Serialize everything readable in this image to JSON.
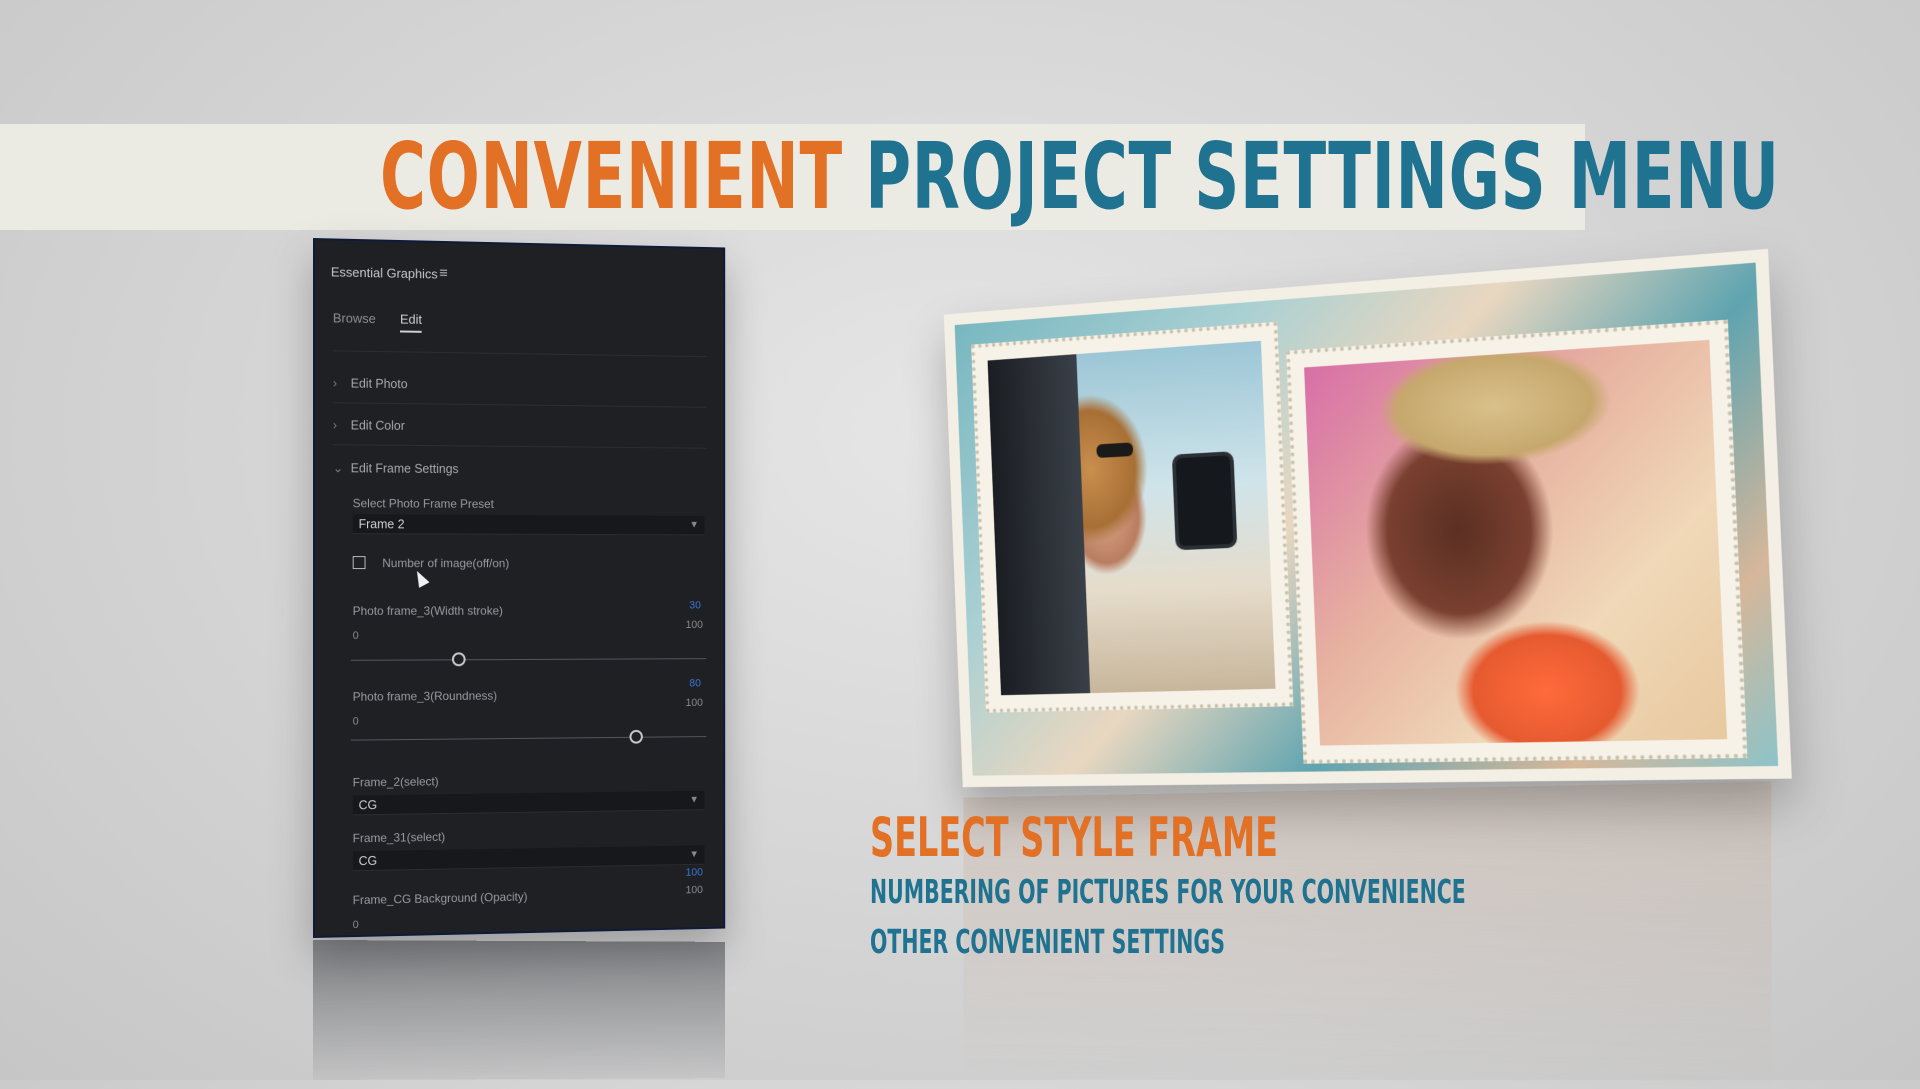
{
  "title": {
    "part1": "CONVENIENT",
    "part2": "PROJECT SETTINGS MENU"
  },
  "panel": {
    "header": "Essential Graphics",
    "menu_icon": "≡",
    "tabs": [
      {
        "label": "Browse"
      },
      {
        "label": "Edit"
      }
    ],
    "sections": [
      {
        "label": "Edit Photo",
        "chevron": "›"
      },
      {
        "label": "Edit Color",
        "chevron": "›"
      },
      {
        "label": "Edit Frame Settings",
        "chevron": "⌄"
      }
    ],
    "preset_label": "Select Photo Frame Preset",
    "preset_value": "Frame 2",
    "checkbox_label": "Number of image(off/on)",
    "slider1": {
      "label": "Photo frame_3(Width stroke)",
      "value": "30",
      "min": "0",
      "max": "100",
      "position": 0.3
    },
    "slider2": {
      "label": "Photo frame_3(Roundness)",
      "value": "80",
      "min": "0",
      "max": "100",
      "position": 0.8
    },
    "select2": {
      "label": "Frame_2(select)",
      "value": "CG"
    },
    "select3": {
      "label": "Frame_31(select)",
      "value": "CG"
    },
    "opacity": {
      "label": "Frame_CG Background (Opacity)",
      "value": "100",
      "min": "0",
      "max": "100"
    }
  },
  "features": {
    "main": "SELECT STYLE FRAME",
    "line1": "NUMBERING OF PICTURES FOR YOUR CONVENIENCE",
    "line2": "OTHER CONVENIENT SETTINGS"
  },
  "colors": {
    "orange": "#e27025",
    "teal": "#1f7390",
    "panel_bg": "#1f2024",
    "slider_accent": "#3a76d8"
  }
}
